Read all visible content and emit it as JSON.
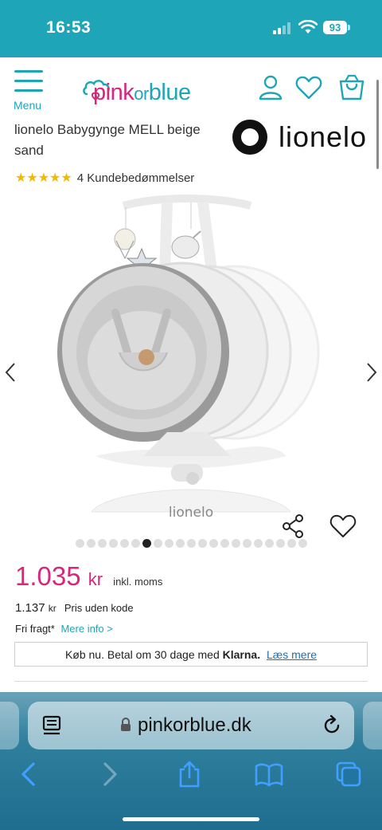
{
  "status_bar": {
    "time": "16:53",
    "battery": "93"
  },
  "header": {
    "menu_label": "Menu",
    "logo": {
      "part1": "pink",
      "part2": "or",
      "part3": "blue"
    },
    "icons": [
      "account-icon",
      "heart-icon",
      "bag-icon"
    ]
  },
  "product": {
    "title": "lionelo Babygynge MELL beige sand",
    "brand": "lionelo",
    "stars": "★★★★★",
    "rating_text": "4 Kundebedømmelser",
    "base_brand_text": "lionelo"
  },
  "gallery": {
    "dot_count": 21,
    "active_dot": 6
  },
  "price": {
    "amount": "1.035",
    "currency": "kr",
    "vat_note": "inkl. moms",
    "old_amount": "1.137",
    "old_currency": "kr",
    "old_label": "Pris uden kode",
    "shipping": "Fri fragt*",
    "shipping_link": "Mere info >"
  },
  "klarna": {
    "text": "Køb nu. Betal om 30 dage med",
    "brand": "Klarna.",
    "link": "Læs mere"
  },
  "browser": {
    "url": "pinkorblue.dk"
  },
  "colors": {
    "accent": "#1ea5b8",
    "brand_pink": "#d8267d",
    "link_blue": "#1e6fb0",
    "star_yellow": "#f5b800"
  }
}
